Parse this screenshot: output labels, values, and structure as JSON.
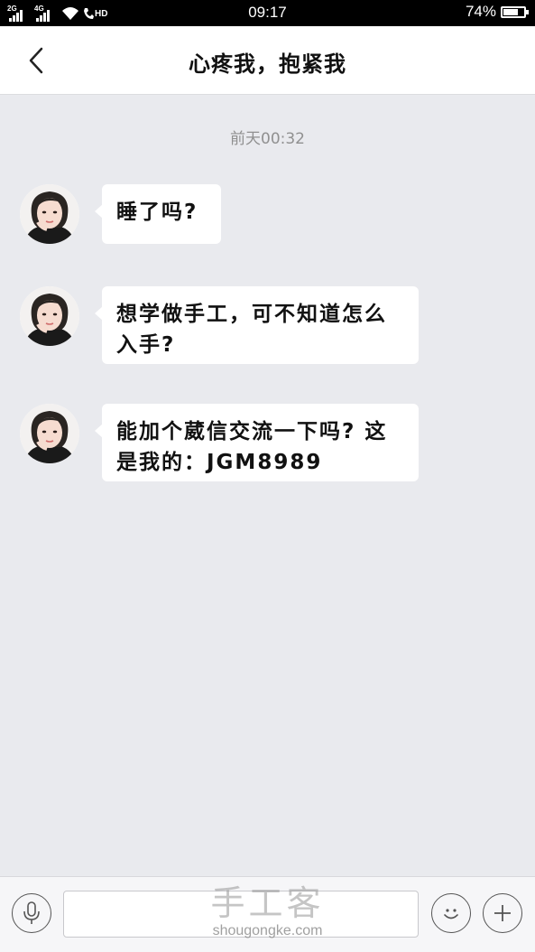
{
  "status_bar": {
    "sim1_label": "2G",
    "sim2_label": "4G",
    "volte_label": "HD",
    "time": "09:17",
    "battery_percent": "74%",
    "battery_level": 0.74
  },
  "header": {
    "title": "心疼我，抱紧我"
  },
  "chat": {
    "timestamp": "前天00:32",
    "messages": [
      {
        "text": "睡了吗?"
      },
      {
        "text": "想学做手工，可不知道怎么入手?"
      },
      {
        "text": "能加个葳信交流一下吗? 这是我的：JGM8989"
      }
    ]
  },
  "watermark": {
    "title": "手工客",
    "subtitle": "shougongke.com"
  },
  "icons": {
    "back": "chevron-left-icon",
    "voice": "microphone-icon",
    "emoji": "smiley-icon",
    "more": "plus-icon"
  }
}
